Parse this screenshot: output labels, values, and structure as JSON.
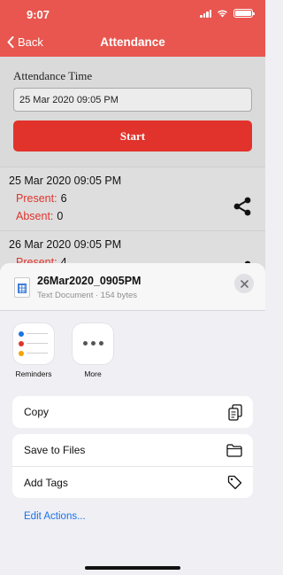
{
  "status_bar": {
    "time": "9:07"
  },
  "nav": {
    "back_label": "Back",
    "title": "Attendance"
  },
  "attendance": {
    "time_label": "Attendance Time",
    "time_value": "25 Mar 2020 09:05 PM",
    "start_label": "Start"
  },
  "records": [
    {
      "date": "25 Mar 2020 09:05 PM",
      "present_label": "Present:",
      "present": "6",
      "absent_label": "Absent:",
      "absent": "0"
    },
    {
      "date": "26 Mar 2020 09:05 PM",
      "present_label": "Present:",
      "present": "4"
    }
  ],
  "share_sheet": {
    "file_name": "26Mar2020_0905PM",
    "file_meta": "Text Document · 154 bytes",
    "apps": [
      {
        "label": "Reminders",
        "icon": "reminders-icon"
      },
      {
        "label": "More",
        "icon": "more-icon"
      }
    ],
    "actions": {
      "copy": "Copy",
      "save_to_files": "Save to Files",
      "add_tags": "Add Tags"
    },
    "edit_actions": "Edit Actions..."
  },
  "colors": {
    "nav_red": "#e8564f",
    "button_red": "#e1332c",
    "link_blue": "#1a73e8"
  }
}
